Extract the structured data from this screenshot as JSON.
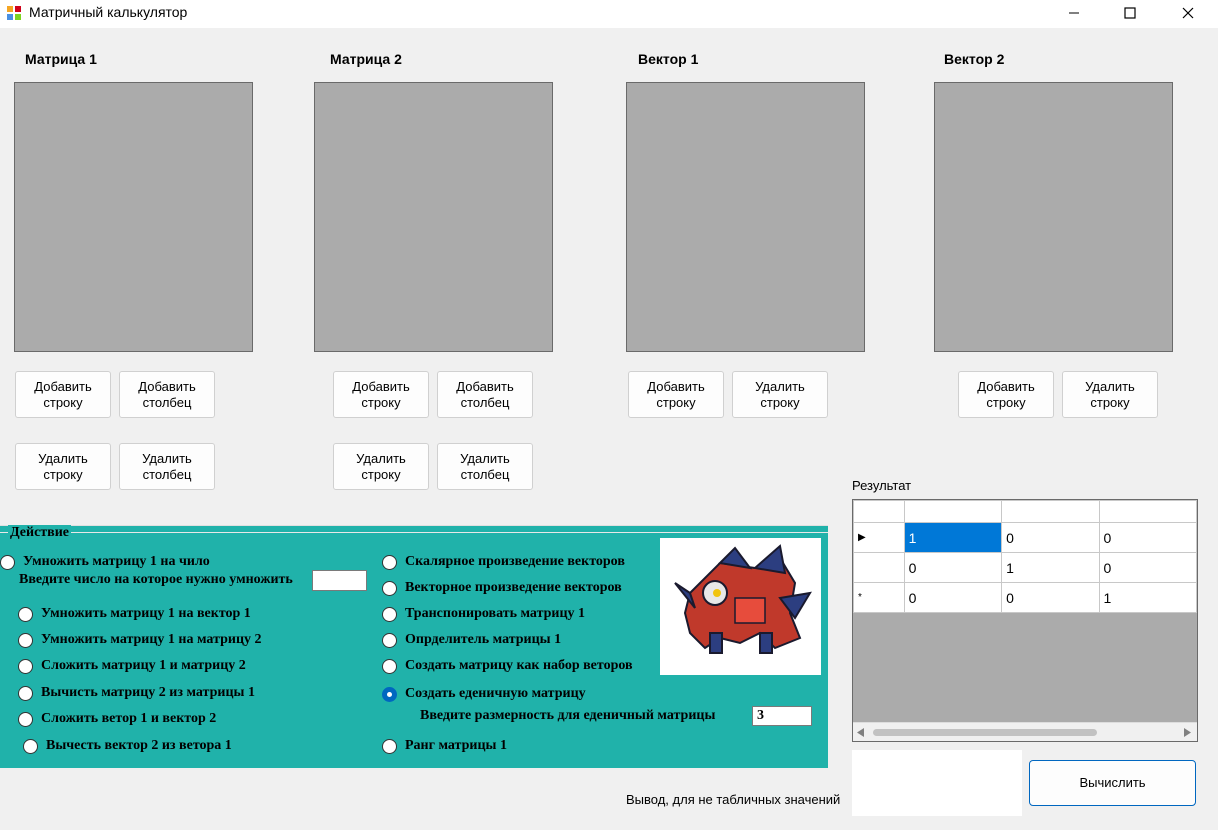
{
  "window": {
    "title": "Матричный калькулятор",
    "minimize": "—",
    "maximize": "☐",
    "close": "✕"
  },
  "groups": {
    "matrix1": {
      "label": "Матрица 1",
      "add_row": "Добавить\nстроку",
      "add_col": "Добавить\nстолбец",
      "del_row": "Удалить\nстроку",
      "del_col": "Удалить\nстолбец"
    },
    "matrix2": {
      "label": "Матрица 2",
      "add_row": "Добавить\nстроку",
      "add_col": "Добавить\nстолбец",
      "del_row": "Удалить\nстроку",
      "del_col": "Удалить\nстолбец"
    },
    "vector1": {
      "label": "Вектор 1",
      "add_row": "Добавить\nстроку",
      "del_row": "Удалить\nстроку"
    },
    "vector2": {
      "label": "Вектор 2",
      "add_row": "Добавить\nстроку",
      "del_row": "Удалить\nстроку"
    }
  },
  "action": {
    "legend": "Действие",
    "multiply_by_number": "Умножить матрицу 1 на чило",
    "number_prompt": "Введите число на которое нужно умножить",
    "number_value": "",
    "left_options": [
      "Умножить матрицу 1 на вектор 1",
      "Умножить матрицу 1 на матрицу 2",
      "Сложить матрицу 1 и матрицу 2",
      "Вычисть матрицу 2 из матрицы 1",
      "Сложить ветор 1 и вектор 2",
      "Вычесть вектор 2 из ветора 1"
    ],
    "right_options": [
      "Скалярное произведение векторов",
      "Векторное произведение векторов",
      "Транспонировать матрицу 1",
      "Опрделитель матрицы 1",
      "Создать матрицу как набор веторов",
      "Создать еденичную матрицу",
      "Ранг матрицы 1"
    ],
    "selected": "Создать еденичную матрицу",
    "size_prompt": "Введите размерность для еденичный матрицы",
    "size_value": "3",
    "image_caption": "pokemon-artwork"
  },
  "result": {
    "label": "Результат",
    "rows": [
      {
        "marker": "▶",
        "cells": [
          "1",
          "0",
          "0"
        ]
      },
      {
        "marker": "",
        "cells": [
          "0",
          "1",
          "0"
        ]
      },
      {
        "marker": "*",
        "cells": [
          "0",
          "0",
          "1"
        ]
      }
    ]
  },
  "output_label": "Вывод, для не табличных значений",
  "output_value": "",
  "compute_button": "Вычислить"
}
